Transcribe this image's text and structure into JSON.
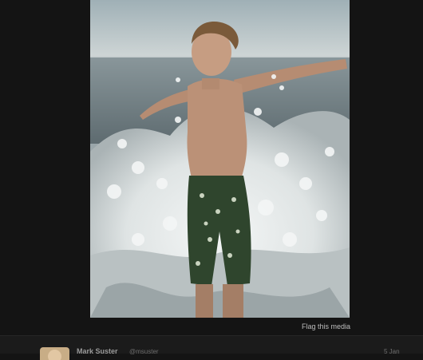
{
  "media": {
    "alt": "Boy splashing in ocean waves",
    "flag_label": "Flag this media"
  },
  "tweet": {
    "author_name": "Mark Suster",
    "author_handle": "@msuster",
    "date": "5 Jan"
  },
  "colors": {
    "background": "#141414",
    "sky": "#b9c4c6",
    "sea": "#6f7d82",
    "splash": "#e9ecec",
    "shorts": "#2f4a2e",
    "skin": "#b98f75"
  }
}
